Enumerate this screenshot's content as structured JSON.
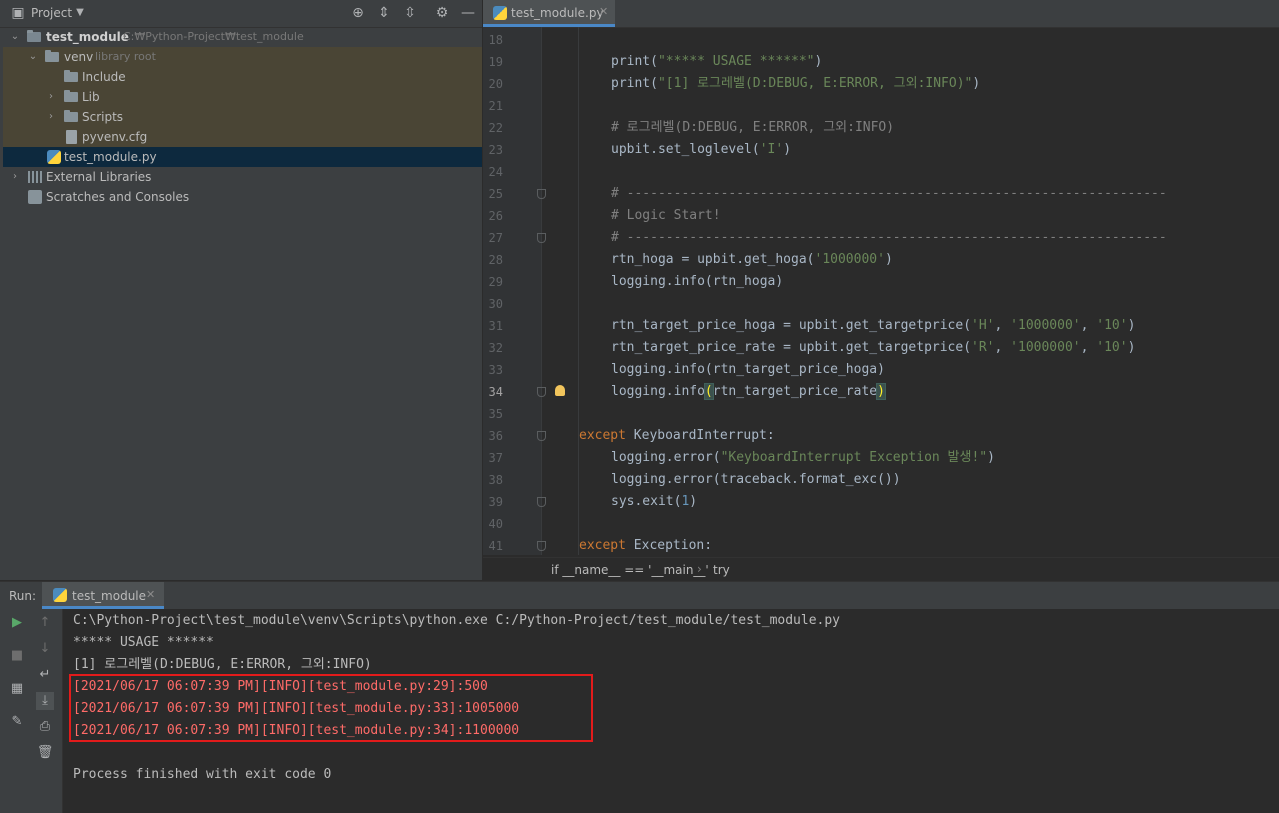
{
  "project_panel": {
    "title": "Project",
    "tree": [
      {
        "label": "test_module",
        "hint": "C:₩Python-Project₩test_module",
        "kind": "root-folder"
      },
      {
        "label": "venv",
        "hint": "library root",
        "kind": "folder"
      },
      {
        "label": "Include",
        "kind": "folder"
      },
      {
        "label": "Lib",
        "kind": "folder"
      },
      {
        "label": "Scripts",
        "kind": "folder"
      },
      {
        "label": "pyvenv.cfg",
        "kind": "file"
      },
      {
        "label": "test_module.py",
        "kind": "python-file"
      },
      {
        "label": "External Libraries",
        "kind": "libraries"
      },
      {
        "label": "Scratches and Consoles",
        "kind": "scratches"
      }
    ]
  },
  "editor": {
    "tab_label": "test_module.py",
    "current_line": "34",
    "lines": [
      {
        "n": "18"
      },
      {
        "n": "19",
        "parts": [
          [
            "print(",
            ""
          ],
          [
            "\"***** USAGE ******\"",
            "s"
          ],
          [
            ")",
            ""
          ]
        ]
      },
      {
        "n": "20",
        "parts": [
          [
            "print(",
            ""
          ],
          [
            "\"[1] 로그레벨(D:DEBUG, E:ERROR, 그외:INFO)\"",
            "s"
          ],
          [
            ")",
            ""
          ]
        ]
      },
      {
        "n": "21"
      },
      {
        "n": "22",
        "parts": [
          [
            "# 로그레벨(D:DEBUG, E:ERROR, 그외:INFO)",
            "c"
          ]
        ]
      },
      {
        "n": "23",
        "parts": [
          [
            "upbit.set_loglevel(",
            ""
          ],
          [
            "'I'",
            "s"
          ],
          [
            ")",
            ""
          ]
        ]
      },
      {
        "n": "24"
      },
      {
        "n": "25",
        "parts": [
          [
            "# ---------------------------------------------------------------------",
            "c"
          ]
        ]
      },
      {
        "n": "26",
        "parts": [
          [
            "# Logic Start!",
            "c"
          ]
        ]
      },
      {
        "n": "27",
        "parts": [
          [
            "# ---------------------------------------------------------------------",
            "c"
          ]
        ]
      },
      {
        "n": "28",
        "parts": [
          [
            "rtn_hoga = upbit.get_hoga(",
            ""
          ],
          [
            "'1000000'",
            "s"
          ],
          [
            ")",
            ""
          ]
        ]
      },
      {
        "n": "29",
        "parts": [
          [
            "logging.info(rtn_hoga)",
            ""
          ]
        ]
      },
      {
        "n": "30"
      },
      {
        "n": "31",
        "parts": [
          [
            "rtn_target_price_hoga = upbit.get_targetprice(",
            ""
          ],
          [
            "'H'",
            "s"
          ],
          [
            ", ",
            ""
          ],
          [
            "'1000000'",
            "s"
          ],
          [
            ", ",
            ""
          ],
          [
            "'10'",
            "s"
          ],
          [
            ")",
            ""
          ]
        ]
      },
      {
        "n": "32",
        "parts": [
          [
            "rtn_target_price_rate = upbit.get_targetprice(",
            ""
          ],
          [
            "'R'",
            "s"
          ],
          [
            ", ",
            ""
          ],
          [
            "'1000000'",
            "s"
          ],
          [
            ", ",
            ""
          ],
          [
            "'10'",
            "s"
          ],
          [
            ")",
            ""
          ]
        ]
      },
      {
        "n": "33",
        "parts": [
          [
            "logging.info(rtn_target_price_hoga)",
            ""
          ]
        ]
      },
      {
        "n": "34",
        "parts": [
          [
            "logging.info",
            ""
          ],
          [
            "(",
            "paren"
          ],
          [
            "rtn_target_price_rate",
            ""
          ],
          [
            ")",
            "paren"
          ]
        ]
      },
      {
        "n": "35"
      },
      {
        "n": "36",
        "parts": [
          [
            "except ",
            "k"
          ],
          [
            "KeyboardInterrupt",
            "cls"
          ],
          [
            ":",
            ""
          ]
        ]
      },
      {
        "n": "37",
        "parts": [
          [
            "logging.error(",
            ""
          ],
          [
            "\"KeyboardInterrupt Exception 발생!\"",
            "s"
          ],
          [
            ")",
            ""
          ]
        ]
      },
      {
        "n": "38",
        "parts": [
          [
            "logging.error(traceback.format_exc())",
            ""
          ]
        ]
      },
      {
        "n": "39",
        "parts": [
          [
            "sys.exit(",
            ""
          ],
          [
            "1",
            "n"
          ],
          [
            ")",
            ""
          ]
        ]
      },
      {
        "n": "40"
      },
      {
        "n": "41",
        "parts": [
          [
            "except ",
            "k"
          ],
          [
            "Exception",
            "cls"
          ],
          [
            ":",
            ""
          ]
        ]
      }
    ],
    "breadcrumb": [
      "if __name__ == '__main__'",
      "try"
    ]
  },
  "run_panel": {
    "label": "Run:",
    "tab_label": "test_module",
    "output": [
      {
        "text": "C:\\Python-Project\\test_module\\venv\\Scripts\\python.exe C:/Python-Project/test_module/test_module.py",
        "type": "normal"
      },
      {
        "text": "***** USAGE ******",
        "type": "normal"
      },
      {
        "text": "[1] 로그레벨(D:DEBUG, E:ERROR, 그외:INFO)",
        "type": "normal"
      },
      {
        "text": "[2021/06/17 06:07:39 PM][INFO][test_module.py:29]:500",
        "type": "err"
      },
      {
        "text": "[2021/06/17 06:07:39 PM][INFO][test_module.py:33]:1005000",
        "type": "err"
      },
      {
        "text": "[2021/06/17 06:07:39 PM][INFO][test_module.py:34]:1100000",
        "type": "err"
      },
      {
        "text": "",
        "type": "normal"
      },
      {
        "text": "Process finished with exit code 0",
        "type": "normal"
      }
    ]
  },
  "colors": {
    "accent": "#4a88c7",
    "highlight_box": "#e31b1b",
    "error_text": "#ff6b68"
  }
}
